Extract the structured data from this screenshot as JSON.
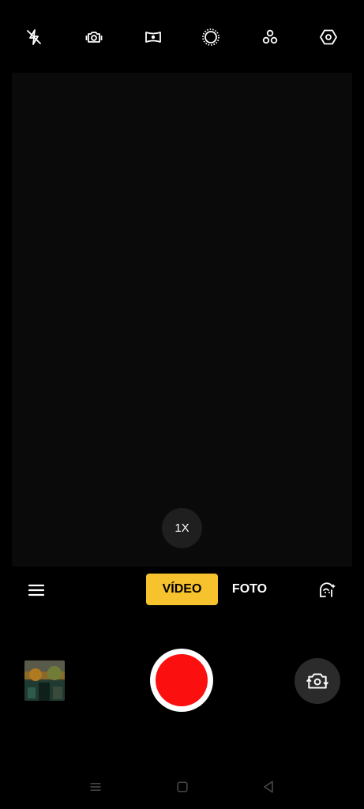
{
  "top_bar": {
    "icons": [
      "flash-off-icon",
      "live-photo-icon",
      "panorama-icon",
      "filter-circle-icon",
      "effects-icon",
      "settings-icon"
    ]
  },
  "zoom": {
    "label": "1X"
  },
  "modes": {
    "menu_icon": "hamburger-icon",
    "video_label": "VÍDEO",
    "photo_label": "FOTO",
    "beauty_icon": "beauty-face-icon"
  },
  "controls": {
    "gallery_thumbnail": "gallery-thumbnail",
    "shutter": "record-button",
    "switch_icon": "switch-camera-icon"
  },
  "colors": {
    "accent": "#f6c22e",
    "record": "#fb0f0f",
    "background": "#000000"
  },
  "nav_bar": {
    "icons": [
      "recents-icon",
      "home-icon",
      "back-icon"
    ]
  }
}
